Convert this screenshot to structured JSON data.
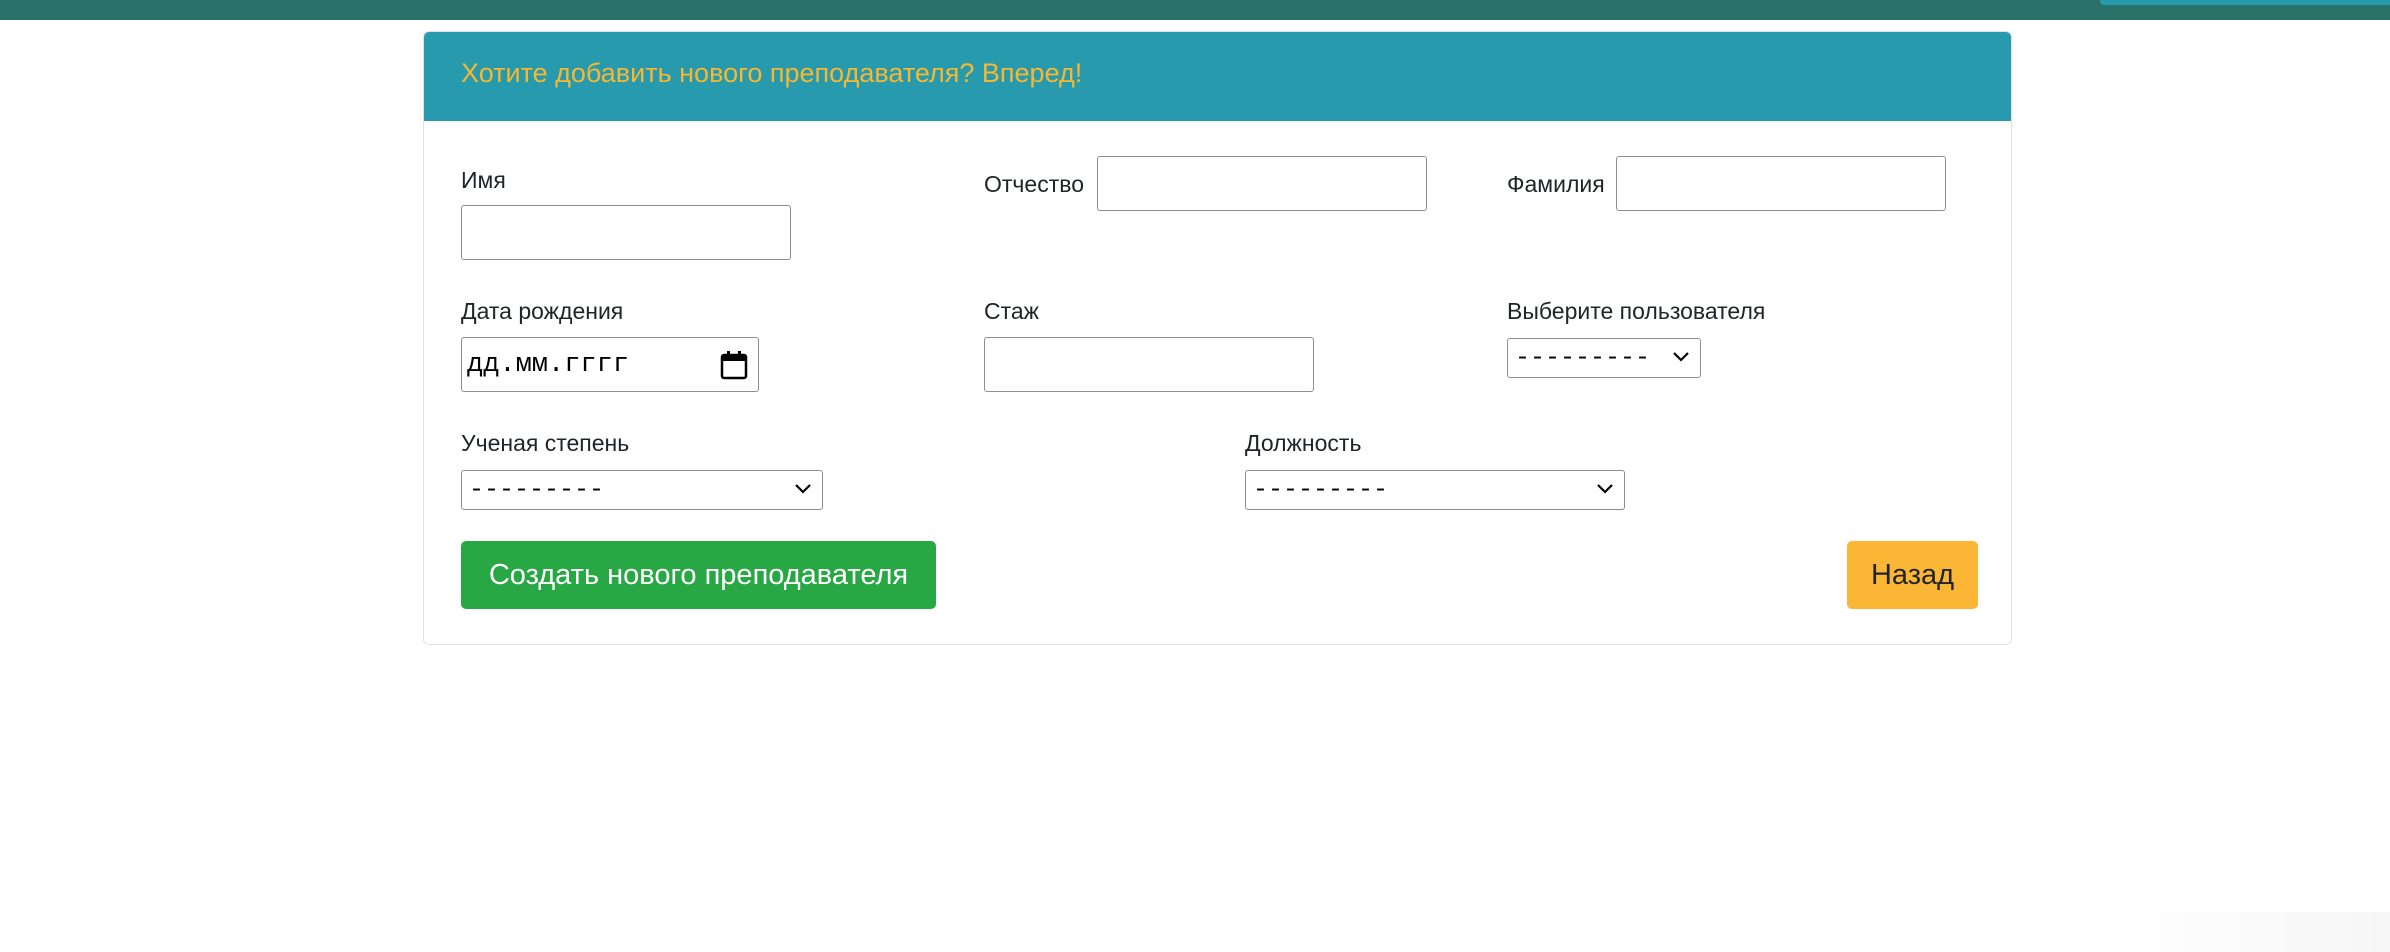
{
  "header": {
    "title": "Хотите добавить нового преподавателя? Вперед!"
  },
  "form": {
    "first_name": {
      "label": "Имя",
      "value": ""
    },
    "middle_name": {
      "label": "Отчество",
      "value": ""
    },
    "last_name": {
      "label": "Фамилия",
      "value": ""
    },
    "birth_date": {
      "label": "Дата рождения",
      "placeholder": "дд.мм.гггг"
    },
    "experience": {
      "label": "Стаж",
      "value": ""
    },
    "user_select": {
      "label": "Выберите пользователя",
      "selected": "---------"
    },
    "degree_select": {
      "label": "Ученая степень",
      "selected": "---------"
    },
    "position_select": {
      "label": "Должность",
      "selected": "---------"
    }
  },
  "buttons": {
    "create_label": "Создать нового преподавателя",
    "back_label": "Назад"
  },
  "colors": {
    "header_bg": "#279aad",
    "header_text": "#f7b731",
    "topbar": "#2a7169",
    "create_button": "#28a745",
    "back_button": "#fbb636"
  },
  "icons": {
    "date_picker": "calendar-icon",
    "select_arrow": "chevron-down-icon"
  }
}
